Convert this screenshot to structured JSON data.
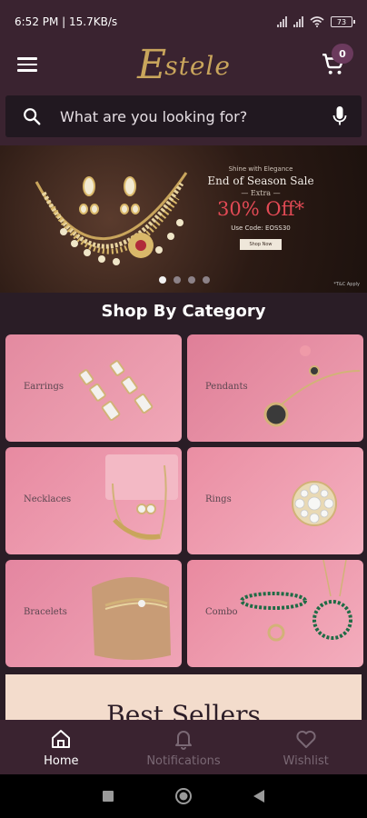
{
  "status_bar": {
    "time_info": "6:52 PM | 15.7KB/s",
    "battery": "73"
  },
  "header": {
    "logo_initial": "E",
    "logo_rest": "stele",
    "cart_count": "0"
  },
  "search": {
    "placeholder": "What are you looking for?"
  },
  "banner": {
    "tagline": "Shine with Elegance",
    "headline": "End of Season Sale",
    "extra": "— Extra —",
    "offer": "30% Off*",
    "code": "Use Code: EOSS30",
    "cta": "Shop Now",
    "tnc": "*T&C Apply",
    "slides": 4,
    "active_slide": 0
  },
  "section_title": "Shop By Category",
  "categories": [
    {
      "label": "Earrings"
    },
    {
      "label": "Pendants"
    },
    {
      "label": "Necklaces"
    },
    {
      "label": "Rings"
    },
    {
      "label": "Bracelets"
    },
    {
      "label": "Combo"
    }
  ],
  "best_sellers": {
    "title": "Best Sellers"
  },
  "bottom_nav": [
    {
      "label": "Home",
      "icon": "home-icon",
      "active": true
    },
    {
      "label": "Notifications",
      "icon": "bell-icon",
      "active": false
    },
    {
      "label": "Wishlist",
      "icon": "heart-icon",
      "active": false
    }
  ],
  "colors": {
    "brand_gold": "#c9a55c",
    "header_bg": "#3a2330",
    "tile_pink": "#e7899c",
    "offer_red": "#e24a55"
  }
}
